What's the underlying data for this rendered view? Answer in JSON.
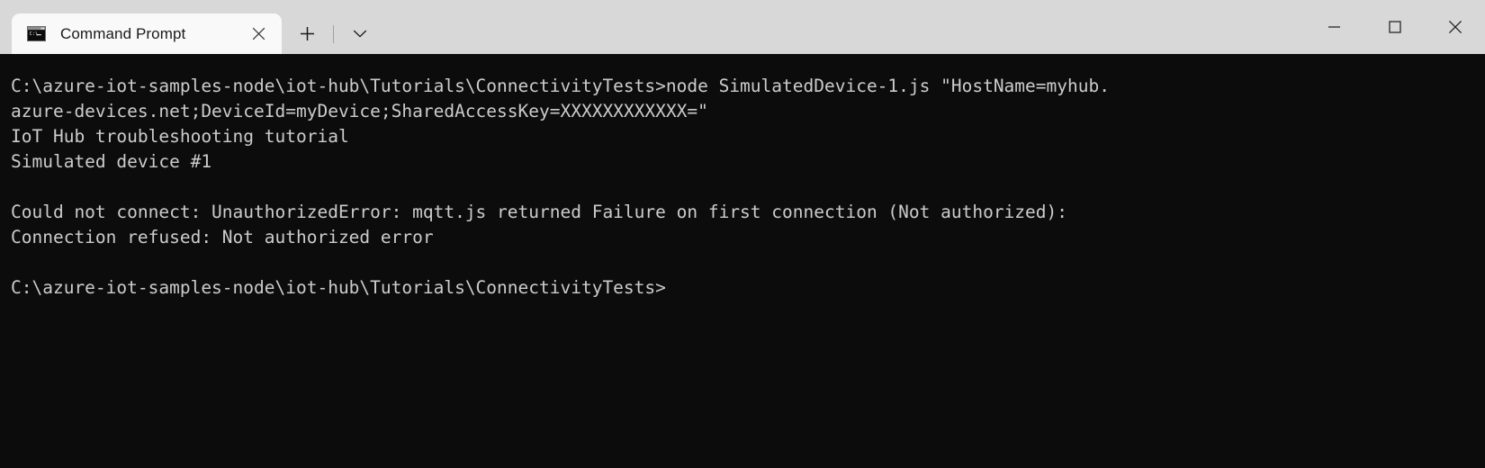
{
  "window": {
    "title": "Command Prompt",
    "colors": {
      "titlebar_bg": "#d8d8d8",
      "active_tab_bg": "#f9f9f9",
      "terminal_bg": "#0c0c0c",
      "terminal_fg": "#cccccc"
    }
  },
  "tabs": [
    {
      "label": "Command Prompt",
      "icon": "command-prompt-icon",
      "active": true,
      "close_icon": "close-icon"
    }
  ],
  "tabstrip": {
    "new_tab_icon": "plus-icon",
    "dropdown_icon": "chevron-down-icon"
  },
  "window_controls": {
    "minimize_icon": "minimize-icon",
    "maximize_icon": "maximize-icon",
    "close_icon": "close-icon"
  },
  "terminal": {
    "lines": [
      "C:\\azure-iot-samples-node\\iot-hub\\Tutorials\\ConnectivityTests>node SimulatedDevice-1.js \"HostName=myhub.",
      "azure-devices.net;DeviceId=myDevice;SharedAccessKey=XXXXXXXXXXXX=\"",
      "IoT Hub troubleshooting tutorial",
      "Simulated device #1",
      "",
      "Could not connect: UnauthorizedError: mqtt.js returned Failure on first connection (Not authorized):",
      "Connection refused: Not authorized error",
      "",
      "C:\\azure-iot-samples-node\\iot-hub\\Tutorials\\ConnectivityTests>"
    ]
  }
}
